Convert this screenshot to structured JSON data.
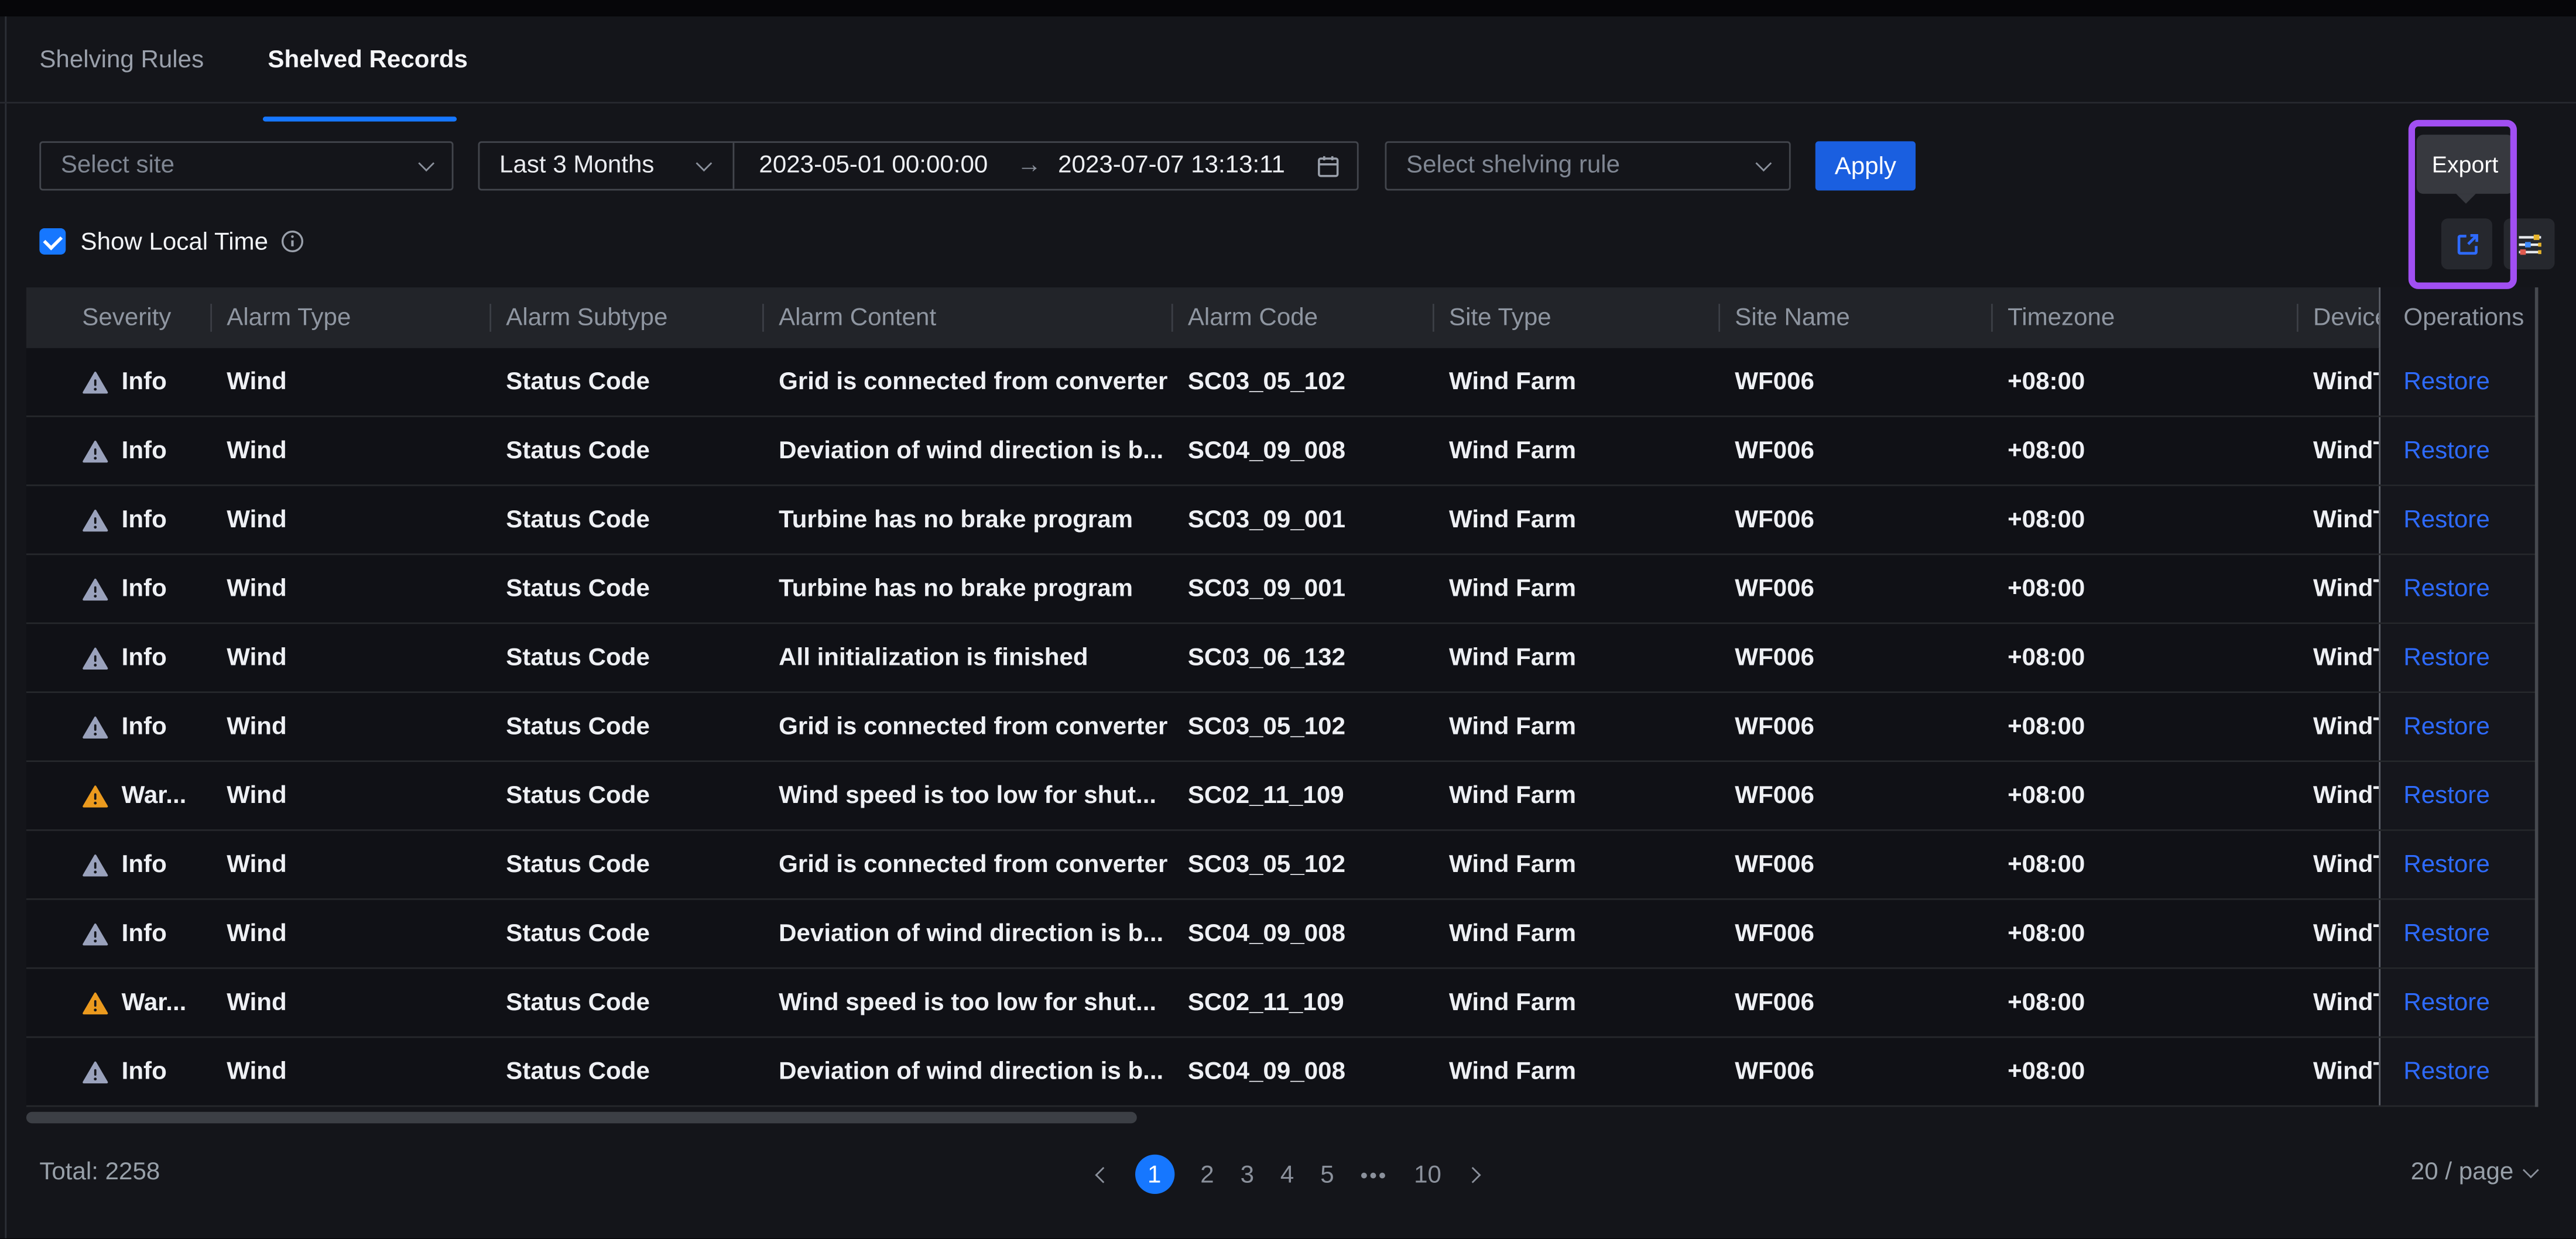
{
  "tabs": {
    "items": [
      {
        "label": "Shelving Rules",
        "active": false
      },
      {
        "label": "Shelved Records",
        "active": true
      }
    ]
  },
  "filters": {
    "site": {
      "placeholder": "Select site"
    },
    "time_range": {
      "preset": "Last 3 Months",
      "start": "2023-05-01 00:00:00",
      "arrow": "→",
      "end": "2023-07-07 13:13:11"
    },
    "shelving_rule": {
      "placeholder": "Select shelving rule"
    },
    "apply_label": "Apply"
  },
  "toolbar": {
    "export_tooltip": "Export"
  },
  "options": {
    "show_local_time": "Show Local Time"
  },
  "table": {
    "columns": [
      "Severity",
      "Alarm Type",
      "Alarm Subtype",
      "Alarm Content",
      "Alarm Code",
      "Site Type",
      "Site Name",
      "Timezone",
      "Device",
      "Operations"
    ],
    "rows": [
      {
        "severity": "Info",
        "level": "info",
        "type": "Wind",
        "subtype": "Status Code",
        "content": "Grid is connected from converter",
        "code": "SC03_05_102",
        "site_type": "Wind Farm",
        "site_name": "WF006",
        "timezone": "+08:00",
        "device": "WindTu",
        "operation": "Restore"
      },
      {
        "severity": "Info",
        "level": "info",
        "type": "Wind",
        "subtype": "Status Code",
        "content": "Deviation of wind direction is b...",
        "code": "SC04_09_008",
        "site_type": "Wind Farm",
        "site_name": "WF006",
        "timezone": "+08:00",
        "device": "WindTu",
        "operation": "Restore"
      },
      {
        "severity": "Info",
        "level": "info",
        "type": "Wind",
        "subtype": "Status Code",
        "content": "Turbine has no brake program",
        "code": "SC03_09_001",
        "site_type": "Wind Farm",
        "site_name": "WF006",
        "timezone": "+08:00",
        "device": "WindTu",
        "operation": "Restore"
      },
      {
        "severity": "Info",
        "level": "info",
        "type": "Wind",
        "subtype": "Status Code",
        "content": "Turbine has no brake program",
        "code": "SC03_09_001",
        "site_type": "Wind Farm",
        "site_name": "WF006",
        "timezone": "+08:00",
        "device": "WindTu",
        "operation": "Restore"
      },
      {
        "severity": "Info",
        "level": "info",
        "type": "Wind",
        "subtype": "Status Code",
        "content": "All initialization is finished",
        "code": "SC03_06_132",
        "site_type": "Wind Farm",
        "site_name": "WF006",
        "timezone": "+08:00",
        "device": "WindTu",
        "operation": "Restore"
      },
      {
        "severity": "Info",
        "level": "info",
        "type": "Wind",
        "subtype": "Status Code",
        "content": "Grid is connected from converter",
        "code": "SC03_05_102",
        "site_type": "Wind Farm",
        "site_name": "WF006",
        "timezone": "+08:00",
        "device": "WindTu",
        "operation": "Restore"
      },
      {
        "severity": "War...",
        "level": "warning",
        "type": "Wind",
        "subtype": "Status Code",
        "content": "Wind speed is too low for shut...",
        "code": "SC02_11_109",
        "site_type": "Wind Farm",
        "site_name": "WF006",
        "timezone": "+08:00",
        "device": "WindTu",
        "operation": "Restore"
      },
      {
        "severity": "Info",
        "level": "info",
        "type": "Wind",
        "subtype": "Status Code",
        "content": "Grid is connected from converter",
        "code": "SC03_05_102",
        "site_type": "Wind Farm",
        "site_name": "WF006",
        "timezone": "+08:00",
        "device": "WindTu",
        "operation": "Restore"
      },
      {
        "severity": "Info",
        "level": "info",
        "type": "Wind",
        "subtype": "Status Code",
        "content": "Deviation of wind direction is b...",
        "code": "SC04_09_008",
        "site_type": "Wind Farm",
        "site_name": "WF006",
        "timezone": "+08:00",
        "device": "WindTu",
        "operation": "Restore"
      },
      {
        "severity": "War...",
        "level": "warning",
        "type": "Wind",
        "subtype": "Status Code",
        "content": "Wind speed is too low for shut...",
        "code": "SC02_11_109",
        "site_type": "Wind Farm",
        "site_name": "WF006",
        "timezone": "+08:00",
        "device": "WindTu",
        "operation": "Restore"
      },
      {
        "severity": "Info",
        "level": "info",
        "type": "Wind",
        "subtype": "Status Code",
        "content": "Deviation of wind direction is b...",
        "code": "SC04_09_008",
        "site_type": "Wind Farm",
        "site_name": "WF006",
        "timezone": "+08:00",
        "device": "WindTu",
        "operation": "Restore"
      }
    ]
  },
  "footer": {
    "total": "Total: 2258",
    "first_page": "1",
    "pages": [
      "2",
      "3",
      "4",
      "5"
    ],
    "ellipsis": "•••",
    "last_page": "10",
    "page_size": "20 / page"
  },
  "colors": {
    "accent_blue": "#1677ff",
    "apply_blue": "#1a5fe0",
    "link_blue": "#2e6bff",
    "warning_orange": "#eb9a1e",
    "info_gray": "#9aa2bc",
    "annotation_purple": "#a14ff2"
  }
}
